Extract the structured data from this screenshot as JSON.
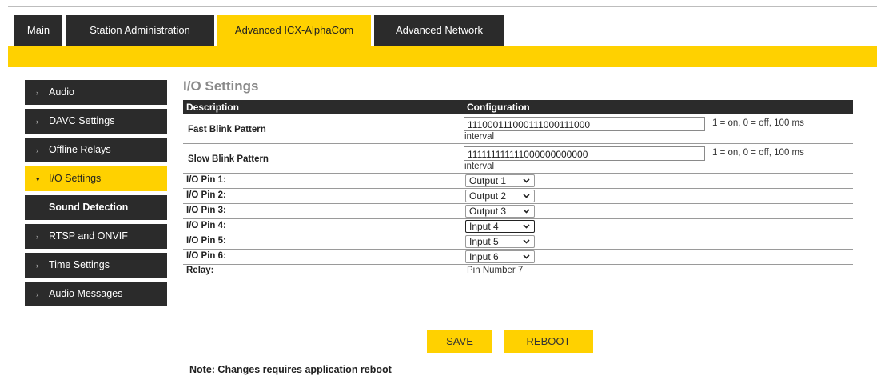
{
  "tabs": [
    {
      "label": "Main",
      "active": false
    },
    {
      "label": "Station Administration",
      "active": false
    },
    {
      "label": "Advanced ICX-AlphaCom",
      "active": true
    },
    {
      "label": "Advanced Network",
      "active": false
    }
  ],
  "sidebar": {
    "items": [
      {
        "label": "Audio"
      },
      {
        "label": "DAVC Settings"
      },
      {
        "label": "Offline Relays"
      },
      {
        "label": "I/O Settings",
        "active": true
      },
      {
        "label": "Sound Detection",
        "sub": true
      },
      {
        "label": "RTSP and ONVIF"
      },
      {
        "label": "Time Settings"
      },
      {
        "label": "Audio Messages"
      }
    ]
  },
  "page": {
    "title": "I/O Settings",
    "table_headers": {
      "description": "Description",
      "configuration": "Configuration"
    },
    "fast_blink": {
      "label": "Fast Blink Pattern",
      "value": "111000111000111000111000",
      "hint": "1 = on, 0 = off, 100 ms",
      "hint2": "interval"
    },
    "slow_blink": {
      "label": "Slow Blink Pattern",
      "value": "111111111111000000000000",
      "hint": "1 = on, 0 = off, 100 ms",
      "hint2": "interval"
    },
    "pins": [
      {
        "label": "I/O Pin 1:",
        "value": "Output 1"
      },
      {
        "label": "I/O Pin 2:",
        "value": "Output 2"
      },
      {
        "label": "I/O Pin 3:",
        "value": "Output 3"
      },
      {
        "label": "I/O Pin 4:",
        "value": "Input 4",
        "focused": true
      },
      {
        "label": "I/O Pin 5:",
        "value": "Input 5"
      },
      {
        "label": "I/O Pin 6:",
        "value": "Input 6"
      }
    ],
    "relay": {
      "label": "Relay:",
      "value": "Pin Number 7"
    },
    "buttons": {
      "save": "SAVE",
      "reboot": "REBOOT"
    },
    "note": "Note: Changes requires application reboot"
  },
  "colors": {
    "accent": "#ffd100",
    "dark": "#2b2b2b"
  }
}
